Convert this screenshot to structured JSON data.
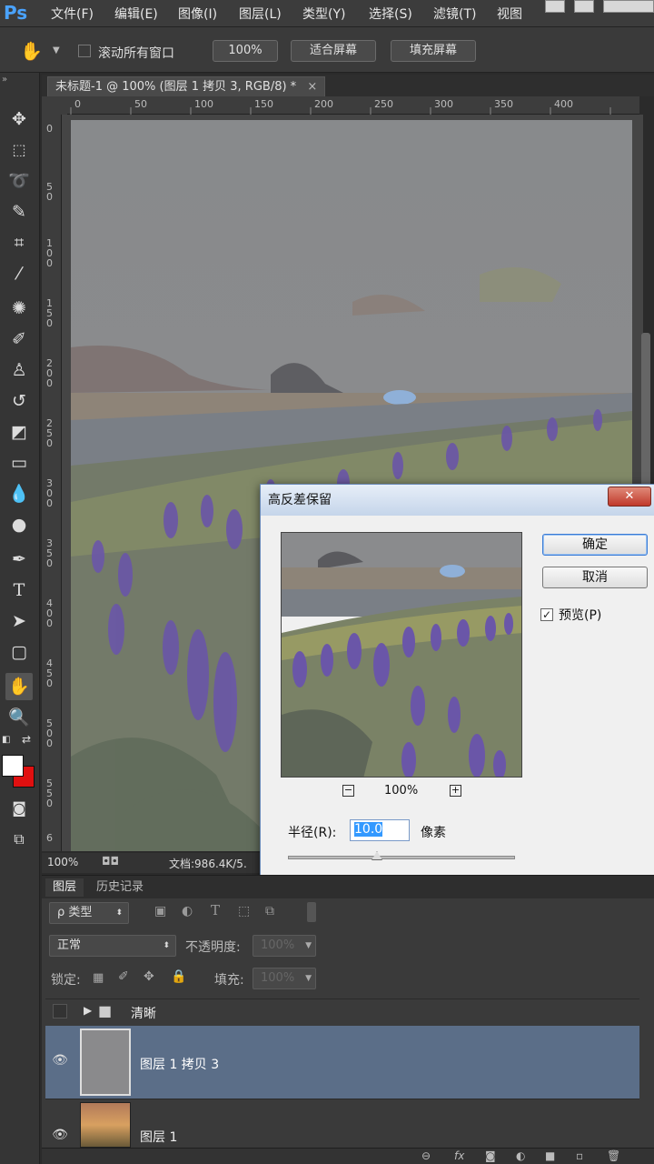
{
  "app": {
    "logo": "Ps"
  },
  "menu": [
    "文件(F)",
    "编辑(E)",
    "图像(I)",
    "图层(L)",
    "类型(Y)",
    "选择(S)",
    "滤镜(T)",
    "视图"
  ],
  "options": {
    "scroll_all_label": "滚动所有窗口",
    "zoom_btn": "100%",
    "fit_screen_btn": "适合屏幕",
    "fill_screen_btn": "填充屏幕"
  },
  "document": {
    "tab_title": "未标题-1 @ 100% (图层 1 拷贝 3, RGB/8) *",
    "ruler_h": [
      "0",
      "50",
      "100",
      "150",
      "200",
      "250",
      "300",
      "350",
      "400"
    ],
    "ruler_v": [
      "0",
      "5 0",
      "1 0 0",
      "1 5 0",
      "2 0 0",
      "2 5 0",
      "3 0 0",
      "3 5 0",
      "4 0 0",
      "4 5 0",
      "5 0 0",
      "5 5 0",
      "6"
    ],
    "zoom": "100%",
    "doc_info": "文档:986.4K/5."
  },
  "dialog": {
    "title": "高反差保留",
    "ok": "确定",
    "cancel": "取消",
    "preview_label": "预览(P)",
    "preview_checked": true,
    "preview_zoom": "100%",
    "radius_label": "半径(R):",
    "radius_value": "10.0",
    "unit": "像素"
  },
  "panels": {
    "tabs": [
      "图层",
      "历史记录"
    ],
    "filter_kind": "ρ 类型",
    "blend_mode": "正常",
    "opacity_label": "不透明度:",
    "opacity_value": "100%",
    "lock_label": "锁定:",
    "fill_label": "填充:",
    "fill_value": "100%",
    "layers": [
      {
        "name": "清晰",
        "type": "group"
      },
      {
        "name": "图层 1 拷贝 3",
        "selected": true
      },
      {
        "name": "图层 1"
      }
    ]
  },
  "colors": {
    "accent": "#4aa3ff",
    "selected_layer": "#5b6e88",
    "foreground": "#ffffff",
    "background": "#e01010"
  }
}
